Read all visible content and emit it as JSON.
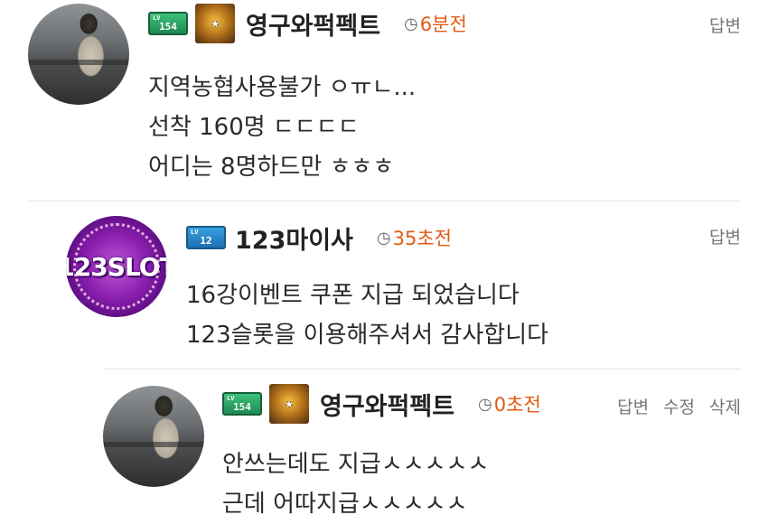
{
  "comments": [
    {
      "nickname": "영구와퍽펙트",
      "level": "154",
      "time": "6분전",
      "actions": [
        "답변"
      ],
      "lines": [
        "지역농협사용불가 ㅇㅠㄴ...",
        "선착 160명 ㄷㄷㄷㄷ",
        "어디는 8명하드만 ㅎㅎㅎ"
      ]
    },
    {
      "nickname": "123마이사",
      "level": "12",
      "avatar_text": "123SLOT",
      "time": "35초전",
      "actions": [
        "답변"
      ],
      "lines": [
        "16강이벤트 쿠폰 지급 되었습니다",
        "123슬롯을 이용해주셔서 감사합니다"
      ]
    },
    {
      "nickname": "영구와퍽펙트",
      "level": "154",
      "time": "0초전",
      "actions": [
        "답변",
        "수정",
        "삭제"
      ],
      "lines": [
        "안쓰는데도 지급ㅅㅅㅅㅅㅅ",
        "근데 어따지급ㅅㅅㅅㅅㅅ"
      ]
    }
  ],
  "icons": {
    "clock": "clock-icon",
    "level_badge": "level-badge-icon",
    "rank_badge": "rank-badge-icon"
  },
  "colors": {
    "time": "#e35a12",
    "action": "#777777",
    "divider": "#e2e2e2"
  }
}
